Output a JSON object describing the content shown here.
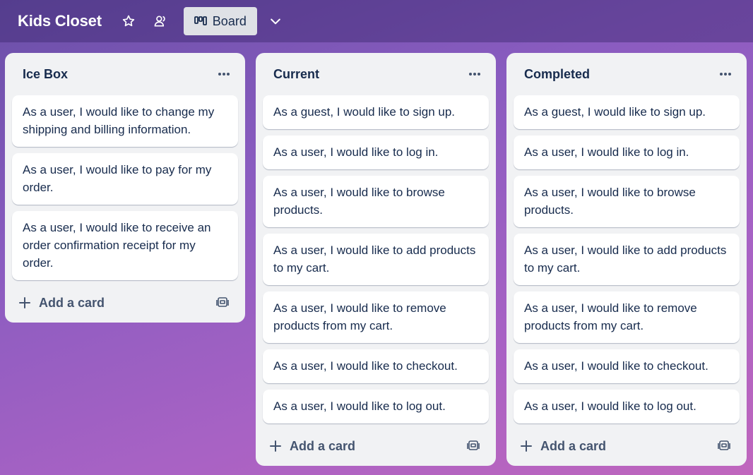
{
  "header": {
    "board_title": "Kids Closet",
    "view_label": "Board",
    "icons": [
      "star-icon",
      "people-icon",
      "board-icon",
      "chevron-down-icon"
    ]
  },
  "lists": [
    {
      "title": "Ice Box",
      "cards": [
        "As a user, I would like to change my shipping and billing information.",
        "As a user, I would like to pay for my order.",
        "As a user, I would like to receive an order confirmation receipt for my order."
      ],
      "add_card_label": "Add a card"
    },
    {
      "title": "Current",
      "cards": [
        "As a guest, I would like to sign up.",
        "As a user, I would like to log in.",
        "As a user, I would like to browse products.",
        "As a user, I would like to add products to my cart.",
        "As a user, I would like to remove products from my cart.",
        "As a user, I would like to checkout.",
        "As a user, I would like to log out."
      ],
      "add_card_label": "Add a card"
    },
    {
      "title": "Completed",
      "cards": [
        "As a guest, I would like to sign up.",
        "As a user, I would like to log in.",
        "As a user, I would like to browse products.",
        "As a user, I would like to add products to my cart.",
        "As a user, I would like to remove products from my cart.",
        "As a user, I would like to checkout.",
        "As a user, I would like to log out."
      ],
      "add_card_label": "Add a card"
    }
  ],
  "colors": {
    "list_bg": "#f1f2f4",
    "card_bg": "#ffffff",
    "text": "#172b4d",
    "view_button_bg": "#dfe1e6"
  }
}
